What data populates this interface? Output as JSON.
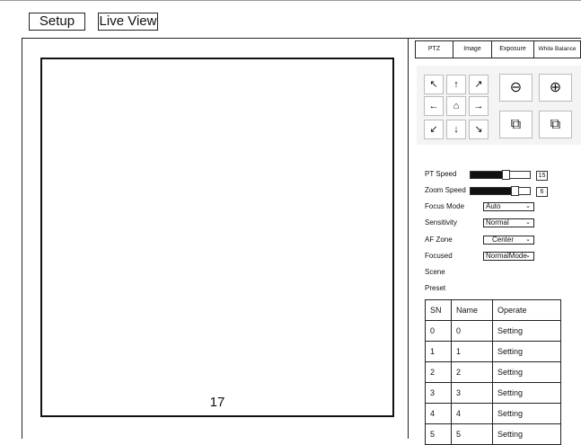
{
  "top_nav": {
    "setup_label": "Setup",
    "live_view_label": "Live View"
  },
  "video": {
    "overlay_number": "17"
  },
  "tabs": [
    {
      "label": "PTZ"
    },
    {
      "label": "Image"
    },
    {
      "label": "Exposure"
    },
    {
      "label": "White Balance"
    }
  ],
  "ptz": {
    "up_left": "↖",
    "up": "↑",
    "up_right": "↗",
    "left": "←",
    "home": "⌂",
    "right": "→",
    "down_left": "↙",
    "down": "↓",
    "down_right": "↘",
    "zoom_out": "⊖",
    "zoom_in": "⊕",
    "focus_near": "⧉",
    "focus_far": "⧉"
  },
  "controls": {
    "pt_speed_label": "PT Speed",
    "pt_speed_value": "15",
    "pt_speed_fraction": 0.6,
    "zoom_speed_label": "Zoom Speed",
    "zoom_speed_value": "6",
    "zoom_speed_fraction": 0.75,
    "focus_mode_label": "Focus Mode",
    "focus_mode_value": "Auto",
    "sensitivity_label": "Sensitivity",
    "sensitivity_value": "Normal",
    "af_zone_label": "AF Zone",
    "af_zone_value": "Center",
    "focused_label": "Focused",
    "focused_value": "NormalMode",
    "scene_label": "Scene",
    "preset_label": "Preset"
  },
  "preset_table": {
    "headers": [
      "SN",
      "Name",
      "Operate"
    ],
    "rows": [
      [
        "0",
        "0",
        "Setting"
      ],
      [
        "1",
        "1",
        "Setting"
      ],
      [
        "2",
        "2",
        "Setting"
      ],
      [
        "3",
        "3",
        "Setting"
      ],
      [
        "4",
        "4",
        "Setting"
      ],
      [
        "5",
        "5",
        "Setting"
      ]
    ]
  }
}
